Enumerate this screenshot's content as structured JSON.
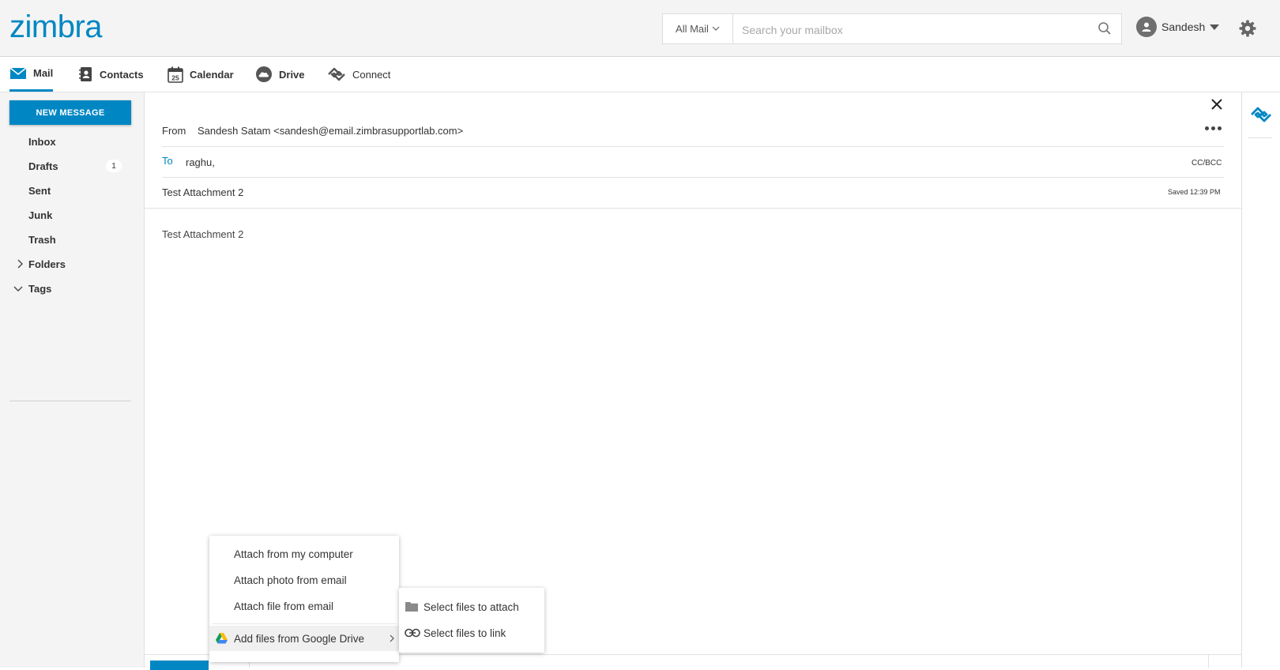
{
  "header": {
    "logo": "zimbra",
    "search_scope": "All Mail",
    "search_placeholder": "Search your mailbox",
    "user_name": "Sandesh"
  },
  "app_tabs": [
    {
      "label": "Mail",
      "icon": "mail-icon"
    },
    {
      "label": "Contacts",
      "icon": "contacts-icon"
    },
    {
      "label": "Calendar",
      "icon": "calendar-icon",
      "icon_text": "25"
    },
    {
      "label": "Drive",
      "icon": "cloud-icon"
    },
    {
      "label": "Connect",
      "icon": "connect-icon"
    }
  ],
  "sidebar": {
    "new_message_label": "NEW MESSAGE",
    "folders": [
      {
        "label": "Inbox"
      },
      {
        "label": "Drafts",
        "count": "1"
      },
      {
        "label": "Sent"
      },
      {
        "label": "Junk"
      },
      {
        "label": "Trash"
      },
      {
        "label": "Folders"
      },
      {
        "label": "Tags"
      }
    ]
  },
  "compose": {
    "from_label": "From",
    "from_value": "Sandesh Satam <sandesh@email.zimbrasupportlab.com>",
    "to_label": "To",
    "to_value": "raghu,",
    "cc_bcc_label": "CC/BCC",
    "subject": "Test Attachment 2",
    "saved_status": "Saved 12:39 PM",
    "body": "Test Attachment 2"
  },
  "attach_menu": {
    "items": [
      {
        "label": "Attach from my computer"
      },
      {
        "label": "Attach photo from email"
      },
      {
        "label": "Attach file from email"
      },
      {
        "label": "Add files from Google Drive"
      }
    ],
    "submenu": [
      {
        "label": "Select files to attach",
        "icon": "folder-icon"
      },
      {
        "label": "Select files to link",
        "icon": "link-icon"
      }
    ]
  },
  "colors": {
    "accent": "#0087c3",
    "header_bg": "#f4f4f4",
    "sidebar_bg": "#f4f4f4"
  }
}
